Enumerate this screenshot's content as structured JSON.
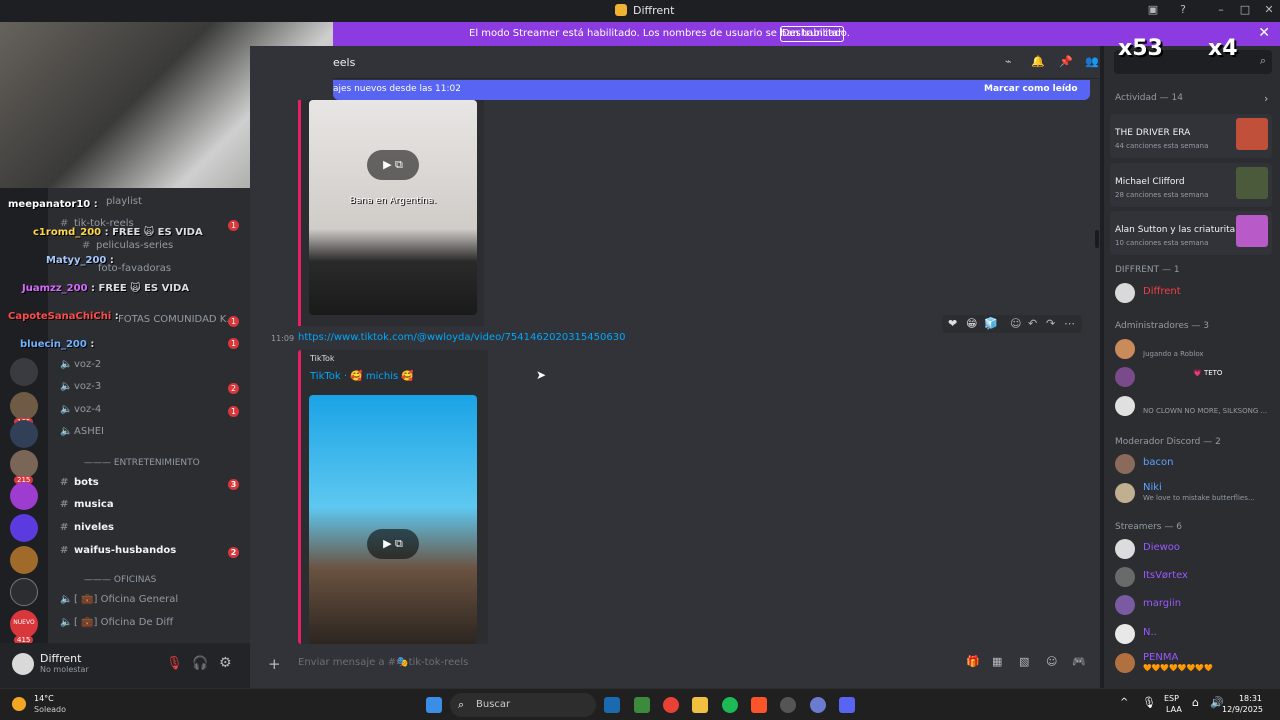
{
  "window": {
    "title": "Diffrent"
  },
  "banner": {
    "text": "El modo Streamer está habilitado. Los nombres de usuario se han truncado.",
    "button": "Deshabilitar"
  },
  "header": {
    "channel_fragment": "eels"
  },
  "newbar": {
    "text": "ajes nuevos desde las 11:02",
    "mark_read": "Marcar como leído"
  },
  "channels": {
    "items": [
      {
        "label": "playlist",
        "y": 0
      },
      {
        "label": "tik-tok-reels",
        "badge": "1"
      },
      {
        "label": "peliculas-series"
      },
      {
        "label": "foto-favadoras"
      },
      {
        "label": "voz-1"
      },
      {
        "label": "FOTAS COMUNIDAD K...",
        "badge": "1"
      },
      {
        "label": "",
        "badge": "1"
      }
    ],
    "voice": [
      {
        "label": "voz-2"
      },
      {
        "label": "voz-3",
        "badge": "2"
      },
      {
        "label": "voz-4",
        "badge": "1"
      },
      {
        "label": "ASHEI"
      }
    ],
    "cat_entretenimiento": "ENTRETENIMIENTO",
    "entretenimiento": [
      {
        "label": "bots",
        "badge": "3"
      },
      {
        "label": "musica"
      },
      {
        "label": "niveles"
      },
      {
        "label": "waifus-husbandos",
        "badge": "2"
      }
    ],
    "cat_oficinas": "OFICINAS",
    "oficinas": [
      {
        "label": "[ 💼] Oficina General"
      },
      {
        "label": "[ 💼] Oficina De Diff"
      }
    ]
  },
  "servers": {
    "badges": [
      "165",
      "215",
      "415"
    ],
    "new_label": "NUEVO"
  },
  "user": {
    "name": "Diffrent",
    "status": "No molestar"
  },
  "stream_chat": [
    {
      "user": "meepanator10",
      "msg": ":",
      "color": "#ffffff"
    },
    {
      "user": "c1romd_200",
      "msg": ": FREE 🙀 ES VIDA",
      "color": "#ffd94a"
    },
    {
      "user": "Matyy_200",
      "msg": ":",
      "color": "#a5c8ff"
    },
    {
      "user": "Juamzz_200",
      "msg": ": FREE 🙀 ES VIDA",
      "color": "#d66bff"
    },
    {
      "user": "CapoteSanaChiChi",
      "msg": ":",
      "color": "#ff4c4c"
    },
    {
      "user": "bluecin_200",
      "msg": ":",
      "color": "#6fb2ff"
    }
  ],
  "overlay": {
    "left_count": "x53",
    "right_count": "x4"
  },
  "message1": {
    "caption": "Bana en Argentina."
  },
  "message2": {
    "time": "11:09",
    "url": "https://www.tiktok.com/@wwloyda/video/7541462020315450630",
    "provider": "TikTok",
    "title": "TikTok · 🥰 michis 🥰"
  },
  "composer": {
    "placeholder": "Enviar mensaje a #🎭tik-tok-reels"
  },
  "members": {
    "activity_header": "Actividad — 14",
    "activities": [
      {
        "title": "THE DRIVER ERA",
        "sub": "44 canciones esta semana"
      },
      {
        "title": "Michael Clifford",
        "sub": "28 canciones esta semana"
      },
      {
        "title": "Alan Sutton y las criaturita...",
        "sub": "10 canciones esta semana"
      }
    ],
    "groups": [
      {
        "label": "DIFFRENT — 1",
        "members": [
          {
            "name": "Diffrent",
            "color": "#f23f43",
            "status": ""
          }
        ]
      },
      {
        "label": "Administradores — 3",
        "members": [
          {
            "name": "",
            "color": "#5865f2",
            "status": "Jugando a Roblox"
          },
          {
            "name": "",
            "color": "#5865f2",
            "status": "💗 TETO"
          },
          {
            "name": "",
            "color": "#5865f2",
            "status": "NO CLOWN NO MORE, SILKSONG ..."
          }
        ]
      },
      {
        "label": "Moderador Discord — 2",
        "members": [
          {
            "name": "bacon",
            "color": "#5ea2ff",
            "status": ""
          },
          {
            "name": "Niki",
            "color": "#5ea2ff",
            "status": "We love to mistake butterflies..."
          }
        ]
      },
      {
        "label": "Streamers — 6",
        "members": [
          {
            "name": "Diewoo",
            "color": "#9b59ff",
            "status": ""
          },
          {
            "name": "ItsVørtex",
            "color": "#9b59ff",
            "status": ""
          },
          {
            "name": "margiin",
            "color": "#9b59ff",
            "status": ""
          },
          {
            "name": "N..",
            "color": "#9b59ff",
            "status": ""
          },
          {
            "name": "PENMA",
            "color": "#9b59ff",
            "status": "🧡🧡🧡🧡🧡🧡🧡🧡"
          }
        ]
      }
    ]
  },
  "taskbar": {
    "weather_temp": "14°C",
    "weather_desc": "Soleado",
    "search": "Buscar",
    "lang1": "ESP",
    "lang2": "LAA",
    "time": "18:31",
    "date": "12/9/2025"
  }
}
